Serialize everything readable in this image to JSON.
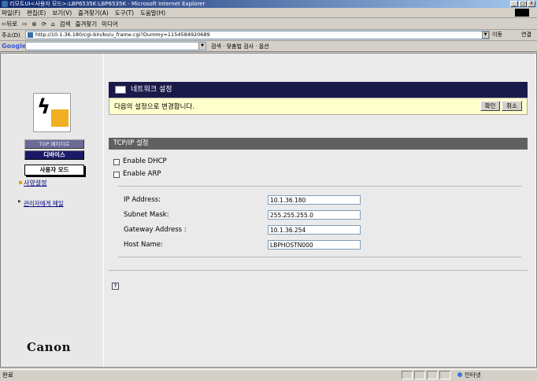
{
  "window": {
    "title": "리모트UI<사용자 모드>:LBP6535K:LBP6535K - Microsoft Internet Explorer",
    "min_label": "_",
    "max_label": "□",
    "close_label": "X"
  },
  "menu": [
    "파일(F)",
    "편집(E)",
    "보기(V)",
    "즐겨찾기(A)",
    "도구(T)",
    "도움말(H)"
  ],
  "toolbar": {
    "back": "⇦뒤로",
    "forward": "⇨",
    "stop": "⊗",
    "refresh": "⟳",
    "home": "⌂",
    "search": "검색",
    "favorites": "즐겨찾기",
    "media": "미디어"
  },
  "address": {
    "label": "주소(D)",
    "url": "http://10.1.36.180/cgi-bin/ko/u_frame.cgi?Dummy=1154584920689",
    "go": "이동",
    "links": "연결"
  },
  "google": {
    "logo": "Google",
    "search": "검색",
    "mysearch": "맞춤법 검사",
    "options": "옵션"
  },
  "sidebar": {
    "top_page": "TOP 페이지로",
    "device": "디바이스",
    "user_mode": "사용자 모드",
    "spec_settings": "사양설정",
    "mail_admin": "관리자에게 메일",
    "brand": "Canon"
  },
  "main": {
    "section_title": "네트워크 설정",
    "confirm_message": "다음의 설정으로 변경합니다.",
    "ok": "확인",
    "cancel": "취소",
    "tcp_title": "TCP/IP 설정",
    "enable_dhcp": "Enable DHCP",
    "enable_arp": "Enable ARP",
    "ip_label": "IP Address:",
    "ip_value": "10.1.36.180",
    "subnet_label": "Subnet Mask:",
    "subnet_value": "255.255.255.0",
    "gateway_label": "Gateway Address :",
    "gateway_value": "10.1.36.254",
    "host_label": "Host Name:",
    "host_value": "LBPHOSTN000",
    "help_glyph": "?"
  },
  "status": {
    "text": "완료",
    "zone": "인터넷"
  }
}
